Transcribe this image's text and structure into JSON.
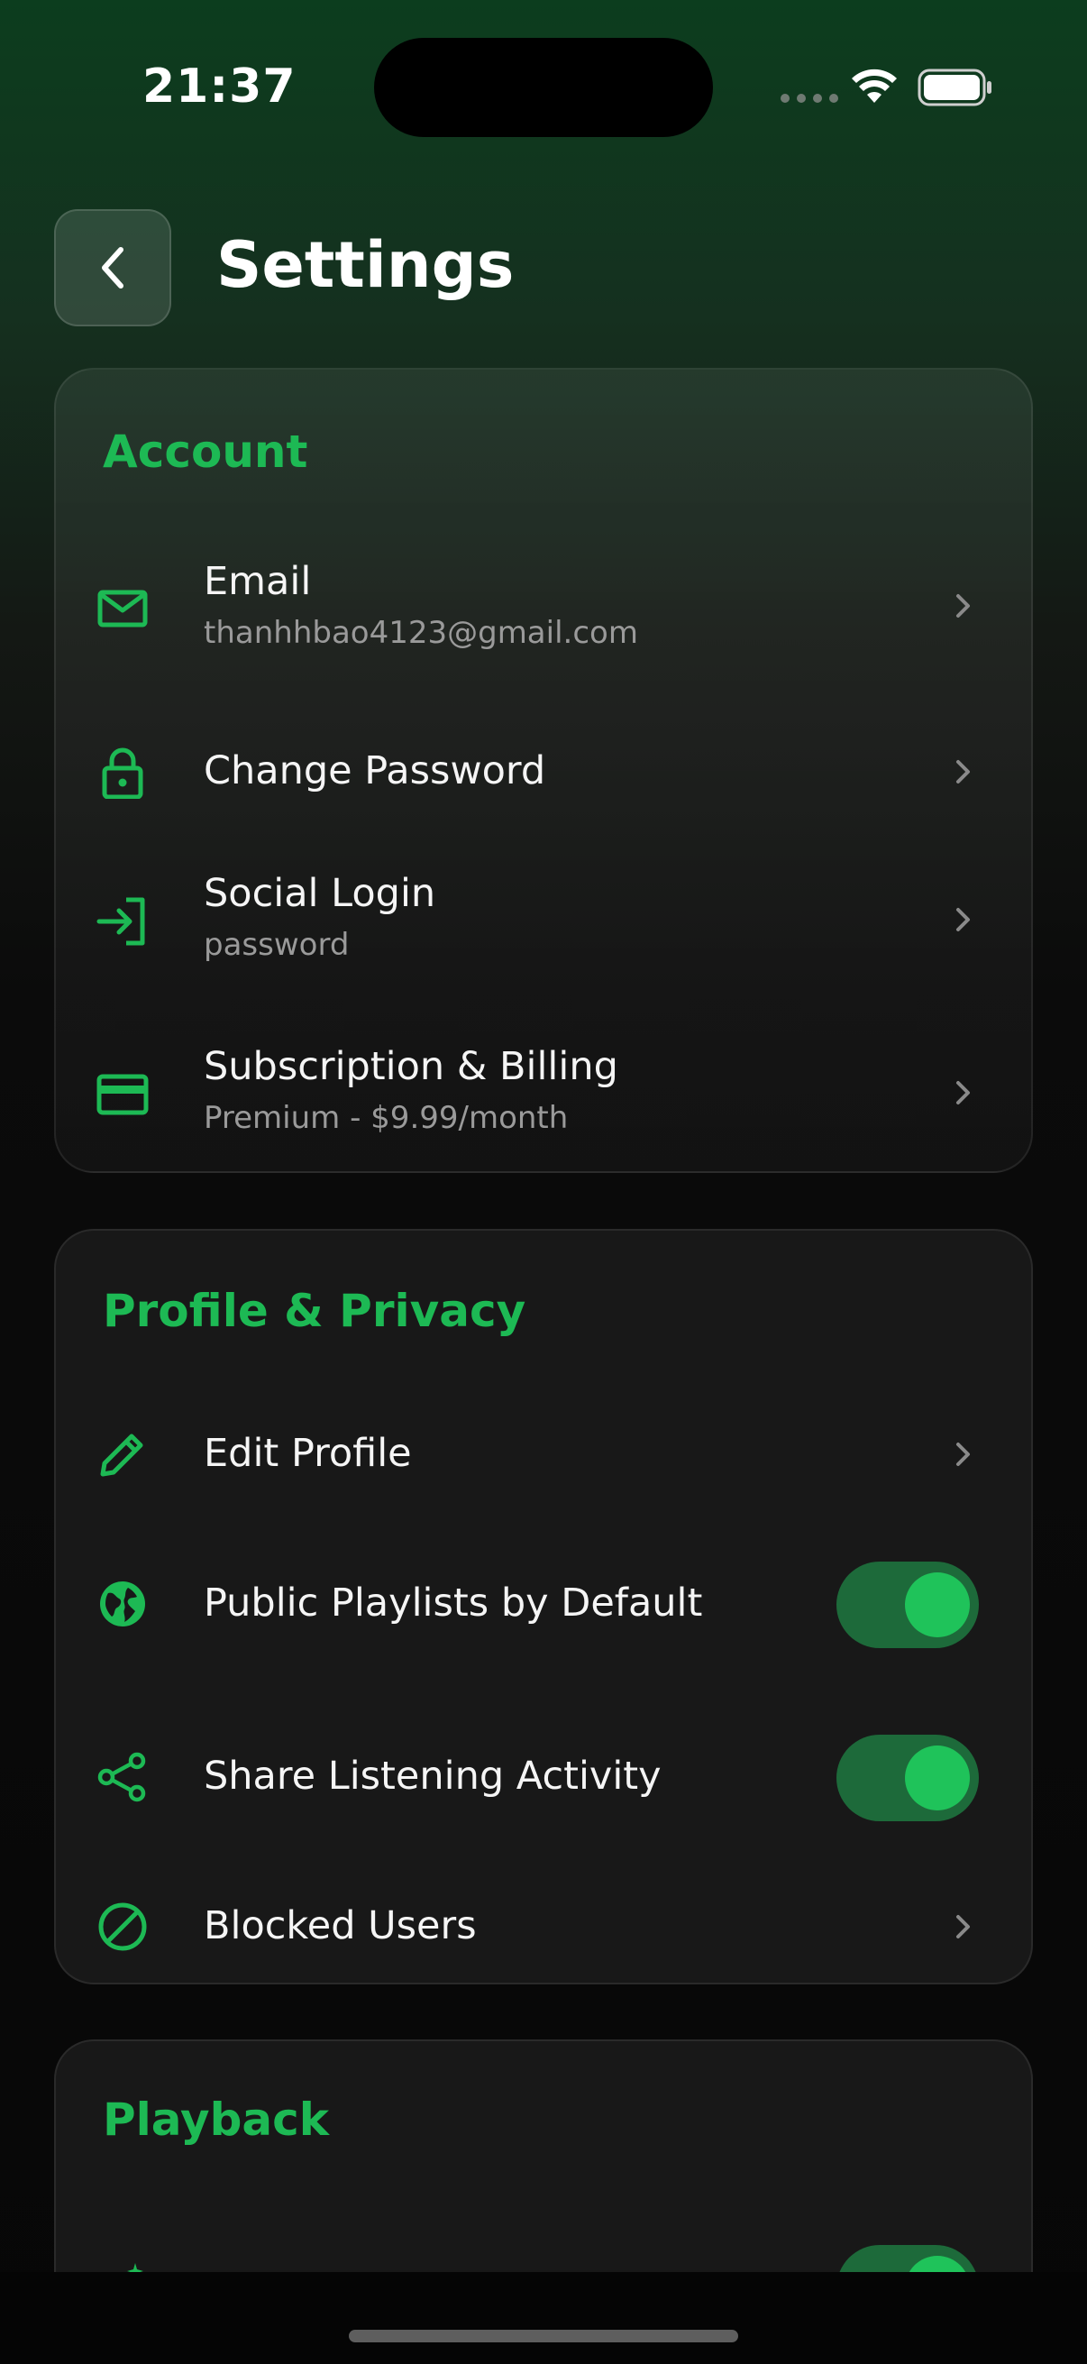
{
  "status_bar": {
    "time": "21:37"
  },
  "header": {
    "title": "Settings"
  },
  "colors": {
    "accent": "#1db954",
    "toggle_track": "#1d6a3a",
    "background": "#0b0b0b"
  },
  "sections": {
    "account": {
      "title": "Account",
      "items": [
        {
          "label": "Email",
          "subtitle": "thanhhbao4123@gmail.com",
          "icon": "mail-icon"
        },
        {
          "label": "Change Password",
          "icon": "lock-icon"
        },
        {
          "label": "Social Login",
          "subtitle": "password",
          "icon": "login-icon"
        },
        {
          "label": "Subscription & Billing",
          "subtitle": "Premium - $9.99/month",
          "icon": "credit-card-icon"
        }
      ]
    },
    "privacy": {
      "title": "Profile & Privacy",
      "items": [
        {
          "label": "Edit Profile",
          "icon": "pencil-icon"
        },
        {
          "label": "Public Playlists by Default",
          "icon": "globe-icon",
          "toggle": true
        },
        {
          "label": "Share Listening Activity",
          "icon": "share-icon",
          "toggle": true
        },
        {
          "label": "Blocked Users",
          "icon": "blocked-icon"
        }
      ]
    },
    "playback": {
      "title": "Playback",
      "items": [
        {
          "icon": "sparkles-icon",
          "toggle": true
        }
      ]
    }
  }
}
